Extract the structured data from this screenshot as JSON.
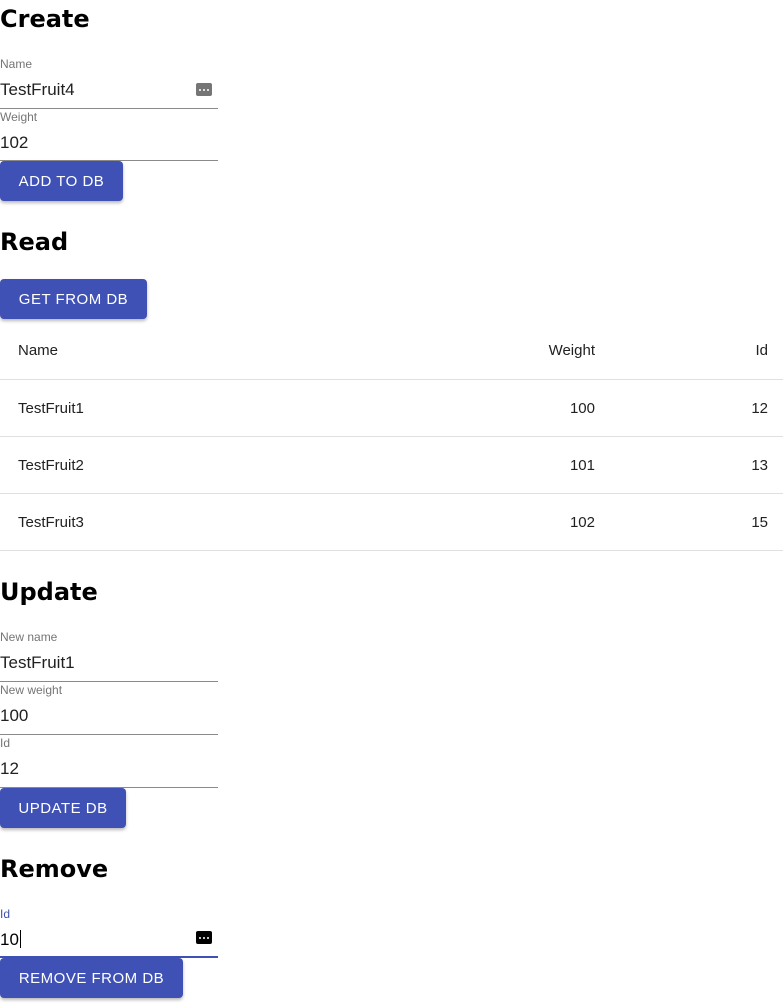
{
  "create": {
    "title": "Create",
    "name_label": "Name",
    "name_value": "TestFruit4",
    "weight_label": "Weight",
    "weight_value": "102",
    "button": "Add to DB",
    "name_icon": "password-manager-icon"
  },
  "read": {
    "title": "Read",
    "button": "Get from DB",
    "columns": [
      "Name",
      "Weight",
      "Id"
    ],
    "rows": [
      {
        "name": "TestFruit1",
        "weight": "100",
        "id": "12"
      },
      {
        "name": "TestFruit2",
        "weight": "101",
        "id": "13"
      },
      {
        "name": "TestFruit3",
        "weight": "102",
        "id": "15"
      }
    ]
  },
  "update": {
    "title": "Update",
    "name_label": "New name",
    "name_value": "TestFruit1",
    "weight_label": "New weight",
    "weight_value": "100",
    "id_label": "Id",
    "id_value": "12",
    "button": "Update DB"
  },
  "remove": {
    "title": "Remove",
    "id_label": "Id",
    "id_value": "10",
    "button": "Remove from DB",
    "id_icon": "password-manager-icon"
  },
  "colors": {
    "primary": "#3f51b5",
    "divider": "#e0e0e0"
  }
}
